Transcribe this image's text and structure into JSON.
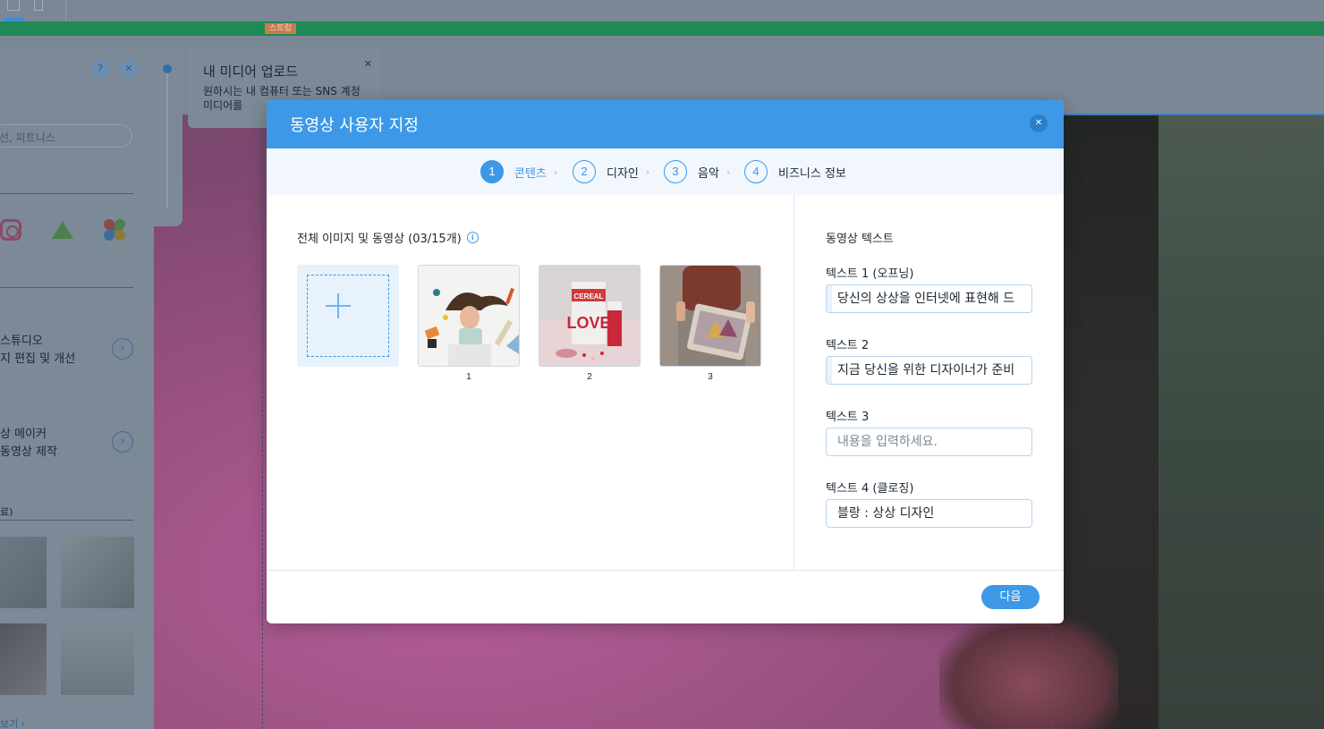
{
  "editor": {
    "strip_tag": "스트립",
    "media_panel": {
      "help_icon": "?",
      "close_icon": "✕",
      "search_placeholder": "선, 피트니스",
      "items": [
        {
          "title": "스튜디오",
          "subtitle": "지 편집 및 개선"
        },
        {
          "title": "상 메이커",
          "subtitle": "동영상 제작"
        }
      ],
      "section_label": "료)",
      "more_link": "보기 ›"
    },
    "upload_tip": {
      "title": "내 미디어 업로드",
      "body": "원하시는 내 컴퓨터 또는 SNS 계정 미디어를",
      "close": "✕"
    }
  },
  "modal": {
    "title": "동영상 사용자 지정",
    "close_icon": "✕",
    "steps": [
      {
        "num": "1",
        "label": "콘텐츠",
        "active": true
      },
      {
        "num": "2",
        "label": "디자인",
        "active": false
      },
      {
        "num": "3",
        "label": "음악",
        "active": false
      },
      {
        "num": "4",
        "label": "비즈니스 정보",
        "active": false
      }
    ],
    "media_section": {
      "title": "전체 이미지 및 동영상 (03/15개)",
      "info_icon": "i",
      "thumbnails": [
        {
          "num": "1",
          "desc": "woman-with-stationery"
        },
        {
          "num": "2",
          "desc": "cereal-love-box"
        },
        {
          "num": "3",
          "desc": "person-drawing-tablet"
        }
      ]
    },
    "text_section": {
      "title": "동영상 텍스트",
      "fields": [
        {
          "label": "텍스트 1 (오프닝)",
          "value": "당신의 상상을 인터넷에 표현해 드",
          "placeholder": ""
        },
        {
          "label": "텍스트 2",
          "value": "지금 당신을 위한 디자이너가 준비",
          "placeholder": ""
        },
        {
          "label": "텍스트 3",
          "value": "",
          "placeholder": "내용을 입력하세요."
        },
        {
          "label": "텍스트 4 (클로징)",
          "value": "블랑 : 상상 디자인",
          "placeholder": ""
        }
      ]
    },
    "next_label": "다음"
  },
  "colors": {
    "accent": "#3d99e7",
    "step_bar_bg": "#f1f7fd"
  }
}
